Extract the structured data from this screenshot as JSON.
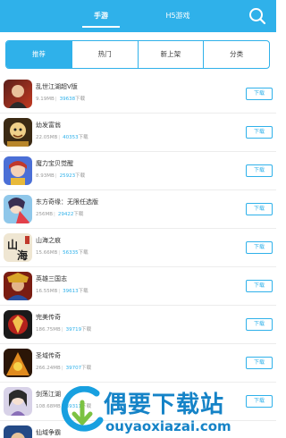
{
  "tabs": [
    {
      "label": "手游",
      "active": true
    },
    {
      "label": "H5游戏",
      "active": false
    }
  ],
  "icons": {
    "search": "search-icon"
  },
  "accent_color": "#2fb1ea",
  "categories": [
    {
      "label": "推荐",
      "active": true
    },
    {
      "label": "热门",
      "active": false
    },
    {
      "label": "新上架",
      "active": false
    },
    {
      "label": "分类",
      "active": false
    }
  ],
  "apps": [
    {
      "name": "乱世江湖超V版",
      "size": "9.19MB",
      "downloads": "39638",
      "suffix": "下载",
      "button": "下载"
    },
    {
      "name": "幼发富翁",
      "size": "22.05MB",
      "downloads": "40353",
      "suffix": "下载",
      "button": "下载"
    },
    {
      "name": "魔力宝贝觉醒",
      "size": "8.93MB",
      "downloads": "25923",
      "suffix": "下载",
      "button": "下载"
    },
    {
      "name": "东方奇缘：无限任选版",
      "size": "256MB",
      "downloads": "29422",
      "suffix": "下载",
      "button": "下载"
    },
    {
      "name": "山海之痕",
      "size": "15.66MB",
      "downloads": "56335",
      "suffix": "下载",
      "button": "下载"
    },
    {
      "name": "英雄三国志",
      "size": "16.55MB",
      "downloads": "39613",
      "suffix": "下载",
      "button": "下载"
    },
    {
      "name": "完美传奇",
      "size": "186.75MB",
      "downloads": "39719",
      "suffix": "下载",
      "button": "下载"
    },
    {
      "name": "圣域传奇",
      "size": "266.24MB",
      "downloads": "39707",
      "suffix": "下载",
      "button": "下载"
    },
    {
      "name": "剑荡江湖",
      "size": "108.68MB",
      "downloads": "39311",
      "suffix": "下载",
      "button": "下载"
    },
    {
      "name": "仙域争霸",
      "size": "",
      "downloads": "",
      "suffix": "",
      "button": ""
    }
  ],
  "watermark": {
    "title": "偶要下载站",
    "url": "ouyaoxiazai.com"
  }
}
